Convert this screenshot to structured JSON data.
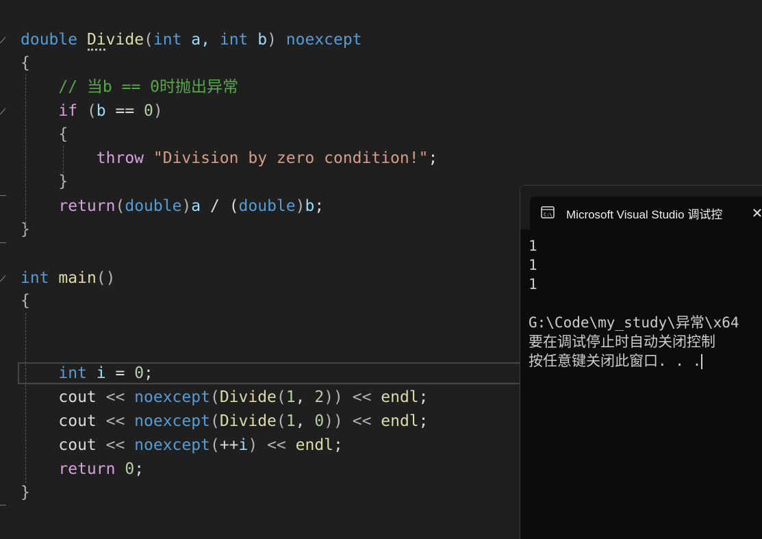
{
  "editor": {
    "lines": [
      [
        {
          "t": "double",
          "c": "kw"
        },
        {
          "t": " ",
          "c": "plain"
        },
        {
          "t": "Divide",
          "c": "fn"
        },
        {
          "t": "(",
          "c": "punc"
        },
        {
          "t": "int",
          "c": "kw"
        },
        {
          "t": " a, ",
          "c": "id"
        },
        {
          "t": "int",
          "c": "kw"
        },
        {
          "t": " b",
          "c": "id"
        },
        {
          "t": ") ",
          "c": "punc"
        },
        {
          "t": "noexcept",
          "c": "kw"
        }
      ],
      [
        {
          "t": "{",
          "c": "punc"
        }
      ],
      [
        {
          "t": "    ",
          "c": "plain"
        },
        {
          "t": "// 当b == 0时抛出异常",
          "c": "cmt"
        }
      ],
      [
        {
          "t": "    ",
          "c": "plain"
        },
        {
          "t": "if",
          "c": "ctl"
        },
        {
          "t": " (",
          "c": "punc"
        },
        {
          "t": "b",
          "c": "id"
        },
        {
          "t": " == ",
          "c": "plain"
        },
        {
          "t": "0",
          "c": "num"
        },
        {
          "t": ")",
          "c": "punc"
        }
      ],
      [
        {
          "t": "    ",
          "c": "plain"
        },
        {
          "t": "{",
          "c": "punc"
        }
      ],
      [
        {
          "t": "        ",
          "c": "plain"
        },
        {
          "t": "throw",
          "c": "ctl"
        },
        {
          "t": " \"Division by zero condition!\"",
          "c": "str"
        },
        {
          "t": ";",
          "c": "plain"
        }
      ],
      [
        {
          "t": "    ",
          "c": "plain"
        },
        {
          "t": "}",
          "c": "punc"
        }
      ],
      [
        {
          "t": "    ",
          "c": "plain"
        },
        {
          "t": "return",
          "c": "ctl"
        },
        {
          "t": "(",
          "c": "punc"
        },
        {
          "t": "double",
          "c": "kw"
        },
        {
          "t": ")",
          "c": "punc"
        },
        {
          "t": "a",
          "c": "id"
        },
        {
          "t": " / (",
          "c": "plain"
        },
        {
          "t": "double",
          "c": "kw"
        },
        {
          "t": ")",
          "c": "punc"
        },
        {
          "t": "b",
          "c": "id"
        },
        {
          "t": ";",
          "c": "plain"
        }
      ],
      [
        {
          "t": "}",
          "c": "punc"
        }
      ],
      [],
      [
        {
          "t": "int",
          "c": "kw"
        },
        {
          "t": " ",
          "c": "plain"
        },
        {
          "t": "main",
          "c": "fn"
        },
        {
          "t": "()",
          "c": "punc"
        }
      ],
      [
        {
          "t": "{",
          "c": "punc"
        }
      ],
      [],
      [],
      [
        {
          "t": "    ",
          "c": "plain"
        },
        {
          "t": "int",
          "c": "kw"
        },
        {
          "t": " i",
          "c": "id"
        },
        {
          "t": " = ",
          "c": "plain"
        },
        {
          "t": "0",
          "c": "num"
        },
        {
          "t": ";",
          "c": "plain"
        }
      ],
      [
        {
          "t": "    ",
          "c": "plain"
        },
        {
          "t": "cout",
          "c": "plain"
        },
        {
          "t": " << ",
          "c": "punc"
        },
        {
          "t": "noexcept",
          "c": "kw"
        },
        {
          "t": "(",
          "c": "punc"
        },
        {
          "t": "Divide",
          "c": "fn"
        },
        {
          "t": "(",
          "c": "punc"
        },
        {
          "t": "1",
          "c": "num"
        },
        {
          "t": ", ",
          "c": "plain"
        },
        {
          "t": "2",
          "c": "num"
        },
        {
          "t": ")) ",
          "c": "punc"
        },
        {
          "t": "<< ",
          "c": "punc"
        },
        {
          "t": "endl",
          "c": "fn"
        },
        {
          "t": ";",
          "c": "plain"
        }
      ],
      [
        {
          "t": "    ",
          "c": "plain"
        },
        {
          "t": "cout",
          "c": "plain"
        },
        {
          "t": " << ",
          "c": "punc"
        },
        {
          "t": "noexcept",
          "c": "kw"
        },
        {
          "t": "(",
          "c": "punc"
        },
        {
          "t": "Divide",
          "c": "fn"
        },
        {
          "t": "(",
          "c": "punc"
        },
        {
          "t": "1",
          "c": "num"
        },
        {
          "t": ", ",
          "c": "plain"
        },
        {
          "t": "0",
          "c": "num"
        },
        {
          "t": ")) ",
          "c": "punc"
        },
        {
          "t": "<< ",
          "c": "punc"
        },
        {
          "t": "endl",
          "c": "fn"
        },
        {
          "t": ";",
          "c": "plain"
        }
      ],
      [
        {
          "t": "    ",
          "c": "plain"
        },
        {
          "t": "cout",
          "c": "plain"
        },
        {
          "t": " << ",
          "c": "punc"
        },
        {
          "t": "noexcept",
          "c": "kw"
        },
        {
          "t": "(",
          "c": "punc"
        },
        {
          "t": "++",
          "c": "plain"
        },
        {
          "t": "i",
          "c": "id"
        },
        {
          "t": ") ",
          "c": "punc"
        },
        {
          "t": "<< ",
          "c": "punc"
        },
        {
          "t": "endl",
          "c": "fn"
        },
        {
          "t": ";",
          "c": "plain"
        }
      ],
      [
        {
          "t": "    ",
          "c": "plain"
        },
        {
          "t": "return",
          "c": "ctl"
        },
        {
          "t": " ",
          "c": "plain"
        },
        {
          "t": "0",
          "c": "num"
        },
        {
          "t": ";",
          "c": "plain"
        }
      ],
      [
        {
          "t": "}",
          "c": "punc"
        }
      ]
    ]
  },
  "console": {
    "title": "Microsoft Visual Studio 调试控",
    "output": [
      "1",
      "1",
      "1",
      "",
      "G:\\Code\\my_study\\异常\\x64",
      "要在调试停止时自动关闭控制",
      "按任意键关闭此窗口. . ."
    ]
  }
}
